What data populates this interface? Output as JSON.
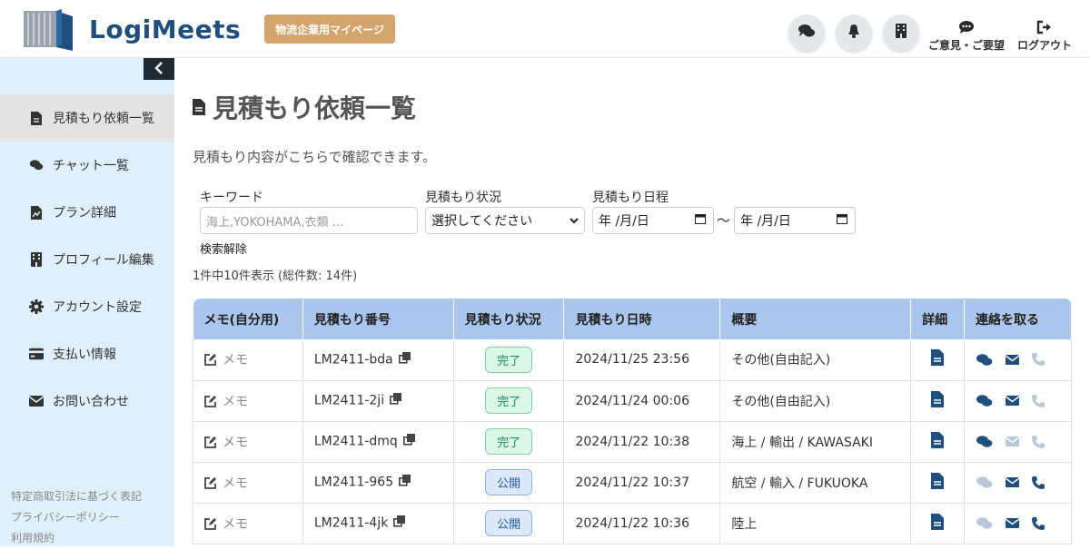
{
  "header": {
    "logo_text": "LogiMeets",
    "company_badge": "物流企業用マイページ",
    "feedback_label": "ご意見・ご要望",
    "logout_label": "ログアウト"
  },
  "sidebar": {
    "items": [
      {
        "label": "見積もり依頼一覧",
        "icon": "document-icon"
      },
      {
        "label": "チャット一覧",
        "icon": "comments-icon"
      },
      {
        "label": "プラン詳細",
        "icon": "file-chart-icon"
      },
      {
        "label": "プロフィール編集",
        "icon": "building-icon"
      },
      {
        "label": "アカウント設定",
        "icon": "gear-icon"
      },
      {
        "label": "支払い情報",
        "icon": "credit-card-icon"
      },
      {
        "label": "お問い合わせ",
        "icon": "envelope-icon"
      }
    ],
    "footer_links": [
      "特定商取引法に基づく表記",
      "プライバシーポリシー",
      "利用規約"
    ]
  },
  "main": {
    "title": "見積もり依頼一覧",
    "subtitle": "見積もり内容がこちらで確認できます。",
    "filters": {
      "keyword_label": "キーワード",
      "keyword_placeholder": "海上,YOKOHAMA,衣類 ...",
      "status_label": "見積もり状況",
      "status_value": "選択してください",
      "date_label": "見積もり日程",
      "date_from": "年 /月/日",
      "date_to": "年 /月/日",
      "tilde": "〜",
      "clear_label": "検索解除"
    },
    "count_text": "1件中10件表示 (総件数: 14件)",
    "table": {
      "headers": [
        "メモ(自分用)",
        "見積もり番号",
        "見積もり状況",
        "見積もり日時",
        "概要",
        "詳細",
        "連絡を取る"
      ],
      "rows": [
        {
          "memo": "メモ",
          "number": "LM2411-bda",
          "status": "完了",
          "status_type": "done",
          "datetime": "2024/11/25 23:56",
          "summary": "その他(自由記入)",
          "chat_enabled": true,
          "mail_enabled": true,
          "phone_enabled": false
        },
        {
          "memo": "メモ",
          "number": "LM2411-2ji",
          "status": "完了",
          "status_type": "done",
          "datetime": "2024/11/24 00:06",
          "summary": "その他(自由記入)",
          "chat_enabled": true,
          "mail_enabled": true,
          "phone_enabled": false
        },
        {
          "memo": "メモ",
          "number": "LM2411-dmq",
          "status": "完了",
          "status_type": "done",
          "datetime": "2024/11/22 10:38",
          "summary": "海上 / 輸出 / KAWASAKI",
          "chat_enabled": true,
          "mail_enabled": false,
          "phone_enabled": false
        },
        {
          "memo": "メモ",
          "number": "LM2411-965",
          "status": "公開",
          "status_type": "public",
          "datetime": "2024/11/22 10:37",
          "summary": "航空 / 輸入 / FUKUOKA",
          "chat_enabled": false,
          "mail_enabled": true,
          "phone_enabled": true
        },
        {
          "memo": "メモ",
          "number": "LM2411-4jk",
          "status": "公開",
          "status_type": "public",
          "datetime": "2024/11/22 10:36",
          "summary": "陸上",
          "chat_enabled": false,
          "mail_enabled": true,
          "phone_enabled": true
        }
      ]
    }
  },
  "colors": {
    "brand": "#1e4f7d",
    "badge": "#d3a46b",
    "sidebar_bg": "#dff0fb",
    "table_header": "#a9c6ec",
    "icon_active": "#1e4f7d",
    "icon_disabled": "#b8c8d8"
  }
}
